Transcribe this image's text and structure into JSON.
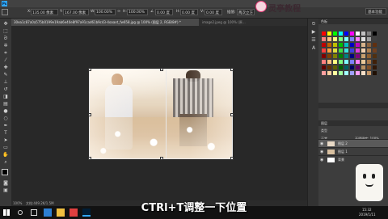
{
  "menubar": {
    "items": [
      "文件(F)",
      "编辑(E)",
      "图像(I)",
      "图层(L)",
      "类型(Y)",
      "选择(S)",
      "滤镜(T)",
      "3D(D)",
      "视图(V)",
      "窗口(W)",
      "帮助(H)"
    ]
  },
  "options": {
    "x_label": "X:",
    "x_value": "135.00 像素",
    "y_label": "Y:",
    "y_value": "167.00 像素",
    "w_label": "W:",
    "w_value": "100.00%",
    "h_label": "H:",
    "h_value": "100.00%",
    "angle_value": "0.00 度",
    "h2_label": "H:",
    "h2_value": "0.00 度",
    "v_label": "V:",
    "v_value": "0.00 度",
    "interp_value": "两次立方",
    "workspace_label": "基本功能"
  },
  "logo": {
    "name": "灵亭教程"
  },
  "tabs": [
    {
      "label": "30ea1c87a0a575b0199e19ab6e40e8f97a91cad61b9c43-4oaaxt_fw658.jpg @ 100% (图层 2, RGB/8#) *",
      "active": true
    },
    {
      "label": "image2.jpeg @ 100% (原…",
      "active": false
    }
  ],
  "panels": {
    "color_title": "色板",
    "layers_title": "图层",
    "layer_tabs": [
      "图层",
      "通道",
      "路径"
    ],
    "kind_label": "类型",
    "blend_mode": "正常",
    "opacity_label": "不透明度: 100%",
    "lock_label": "锁定:",
    "fill_label": "填充: 100%"
  },
  "layers": [
    {
      "name": "图层 2",
      "selected": true
    },
    {
      "name": "图层 1",
      "selected": false
    },
    {
      "name": "背景",
      "selected": false
    }
  ],
  "status": {
    "zoom": "100%",
    "doc": "文档:449.2K/1.5M"
  },
  "subtitle": "CTRl+T调整一下位置",
  "taskbar": {
    "time": "15:32",
    "date": "2019/1/11"
  },
  "colors": {
    "panel": "#3d3d3d",
    "canvas_bg": "#282828",
    "accent": "#e83e7a",
    "swatches": [
      "#ff0000",
      "#ffff00",
      "#00ff00",
      "#00ffff",
      "#0000ff",
      "#ff00ff",
      "#ffffff",
      "#c0c0c0",
      "#808080",
      "#000000",
      "#ff7f7f",
      "#ffbf7f",
      "#ffff7f",
      "#7fff7f",
      "#7fffff",
      "#7f7fff",
      "#ff7fff",
      "#e0e0e0",
      "#a0a0a0",
      "#404040",
      "#c00000",
      "#c06000",
      "#c0c000",
      "#00c000",
      "#00c0c0",
      "#0000c0",
      "#c000c0",
      "#d8b48c",
      "#8c6440",
      "#603010",
      "#ff4040",
      "#ffa040",
      "#e0e040",
      "#40e040",
      "#40e0e0",
      "#4040e0",
      "#e040e0",
      "#f0d0b0",
      "#b08050",
      "#704020",
      "#800000",
      "#804000",
      "#808000",
      "#008000",
      "#008080",
      "#000080",
      "#800080",
      "#c8a070",
      "#906030",
      "#503010",
      "#ff8080",
      "#ffc080",
      "#ffff80",
      "#80ff80",
      "#80ffff",
      "#8080ff",
      "#ff80ff",
      "#e8c898",
      "#a87848",
      "#402008",
      "#600000",
      "#603000",
      "#606000",
      "#006000",
      "#006060",
      "#000060",
      "#600060",
      "#b89060",
      "#805028",
      "#301808",
      "#ffa0a0",
      "#ffd0a0",
      "#ffffa0",
      "#a0ffa0",
      "#a0ffff",
      "#a0a0ff",
      "#ffa0ff",
      "#f8e0c8",
      "#c89868",
      "#201004"
    ]
  }
}
